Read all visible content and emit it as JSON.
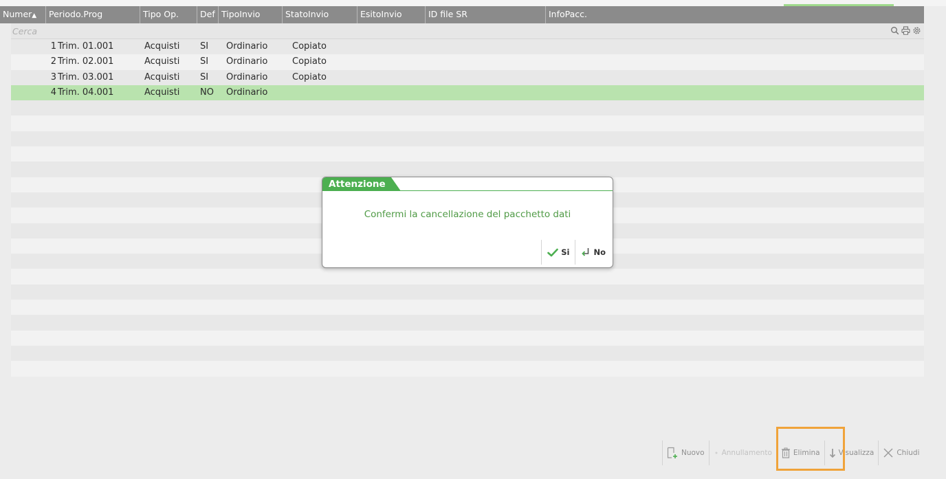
{
  "grid": {
    "headers": [
      {
        "label": "Numer",
        "sort": "▲"
      },
      {
        "label": "Periodo.Prog"
      },
      {
        "label": "Tipo Op."
      },
      {
        "label": "Def"
      },
      {
        "label": "TipoInvio"
      },
      {
        "label": "StatoInvio"
      },
      {
        "label": "EsitoInvio"
      },
      {
        "label": "ID file SR"
      },
      {
        "label": "InfoPacc."
      }
    ],
    "search_placeholder": "Cerca",
    "rows": [
      {
        "numero": "1",
        "periodo": "Trim. 01.001",
        "tipo_op": "Acquisti",
        "def": "SI",
        "tipo_invio": "Ordinario",
        "stato_invio": "Copiato"
      },
      {
        "numero": "2",
        "periodo": "Trim. 02.001",
        "tipo_op": "Acquisti",
        "def": "SI",
        "tipo_invio": "Ordinario",
        "stato_invio": "Copiato"
      },
      {
        "numero": "3",
        "periodo": "Trim. 03.001",
        "tipo_op": "Acquisti",
        "def": "SI",
        "tipo_invio": "Ordinario",
        "stato_invio": "Copiato"
      },
      {
        "numero": "4",
        "periodo": "Trim. 04.001",
        "tipo_op": "Acquisti",
        "def": "NO",
        "tipo_invio": "Ordinario",
        "stato_invio": ""
      }
    ],
    "selected_row_index": 3
  },
  "dialog": {
    "title": "Attenzione",
    "message": "Confermi la cancellazione del pacchetto dati",
    "yes_label": "Si",
    "no_label": "No"
  },
  "toolbar": {
    "nuovo": "Nuovo",
    "annullamento": "Annullamento",
    "elimina": "Elimina",
    "visualizza": "Visualizza",
    "chiudi": "Chiudi"
  },
  "colors": {
    "accent_green": "#4caf50",
    "selected_row": "#b9e3ae",
    "highlight": "#f0a33a",
    "header_bg": "#8b8b8b"
  }
}
